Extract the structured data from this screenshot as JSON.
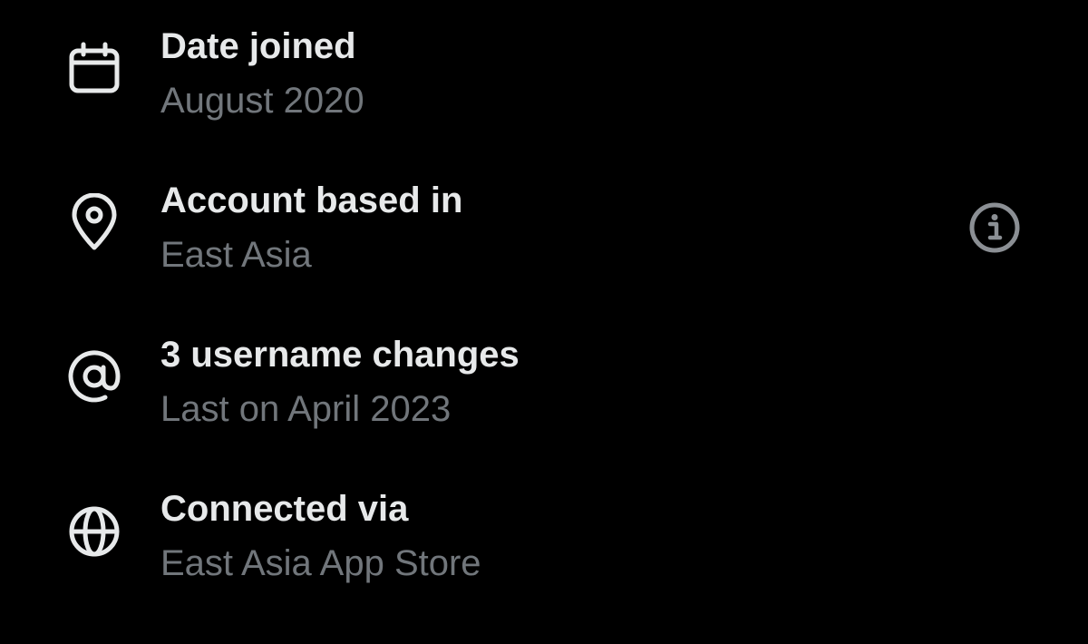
{
  "about": {
    "items": [
      {
        "icon": "calendar-icon",
        "title": "Date joined",
        "subtitle": "August 2020"
      },
      {
        "icon": "location-pin-icon",
        "title": "Account based in",
        "subtitle": "East Asia",
        "action_icon": "info-icon"
      },
      {
        "icon": "at-sign-icon",
        "title": "3 username changes",
        "subtitle": "Last on April 2023"
      },
      {
        "icon": "globe-icon",
        "title": "Connected via",
        "subtitle": "East Asia App Store"
      }
    ]
  },
  "colors": {
    "background": "#000000",
    "primary_text": "#e7e9ea",
    "secondary_text": "#71767b",
    "icon": "#e7e9ea",
    "info_icon": "#8b8f94"
  }
}
